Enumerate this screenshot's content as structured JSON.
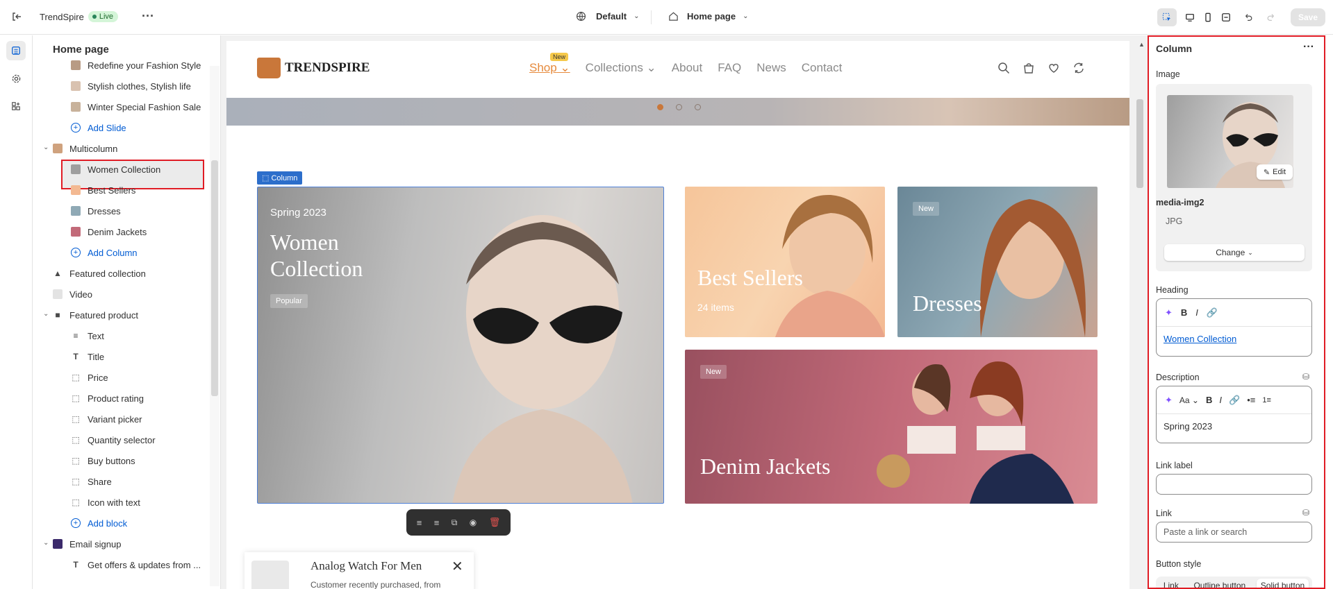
{
  "topbar": {
    "store_name": "TrendSpire",
    "status": "Live",
    "theme": "Default",
    "template": "Home page",
    "save_label": "Save"
  },
  "sidebar": {
    "title": "Home page",
    "slides": [
      "Redefine your Fashion Style",
      "Stylish clothes, Stylish life",
      "Winter Special Fashion Sale"
    ],
    "add_slide": "Add Slide",
    "multicolumn": "Multicolumn",
    "columns": [
      "Women Collection",
      "Best Sellers",
      "Dresses",
      "Denim Jackets"
    ],
    "add_column": "Add Column",
    "featured_collection": "Featured collection",
    "video": "Video",
    "featured_product": "Featured product",
    "product_blocks": [
      "Text",
      "Title",
      "Price",
      "Product rating",
      "Variant picker",
      "Quantity selector",
      "Buy buttons",
      "Share",
      "Icon with text"
    ],
    "add_block": "Add block",
    "email_signup": "Email signup",
    "email_child": "Get offers & updates from ..."
  },
  "preview": {
    "logo": "TRENDSPIRE",
    "menu": {
      "shop": "Shop",
      "new_tag": "New",
      "collections": "Collections",
      "about": "About",
      "faq": "FAQ",
      "news": "News",
      "contact": "Contact"
    },
    "column_tag": "Column",
    "women": {
      "eyebrow": "Spring 2023",
      "title_line1": "Women",
      "title_line2": "Collection",
      "tag": "Popular"
    },
    "best": {
      "title": "Best Sellers",
      "sub": "24 items"
    },
    "dresses": {
      "tag": "New",
      "title": "Dresses"
    },
    "denim": {
      "tag": "New",
      "title": "Denim Jackets"
    },
    "popup": {
      "title": "Analog Watch For Men",
      "text": "Customer recently purchased, from"
    }
  },
  "panel": {
    "title": "Column",
    "image_label": "Image",
    "image_name": "media-img2",
    "image_type": "JPG",
    "edit_label": "Edit",
    "change_label": "Change",
    "heading_label": "Heading",
    "heading_value": "Women Collection",
    "description_label": "Description",
    "font_size_label": "Aa",
    "description_value": "Spring 2023",
    "link_label_label": "Link label",
    "link_label_value": "",
    "link_label": "Link",
    "link_placeholder": "Paste a link or search",
    "button_style_label": "Button style",
    "button_styles": [
      "Link",
      "Outline button",
      "Solid button"
    ]
  },
  "colors": {
    "accent": "#005bd3",
    "highlight": "#e01b24",
    "brand": "#e68a3c"
  }
}
